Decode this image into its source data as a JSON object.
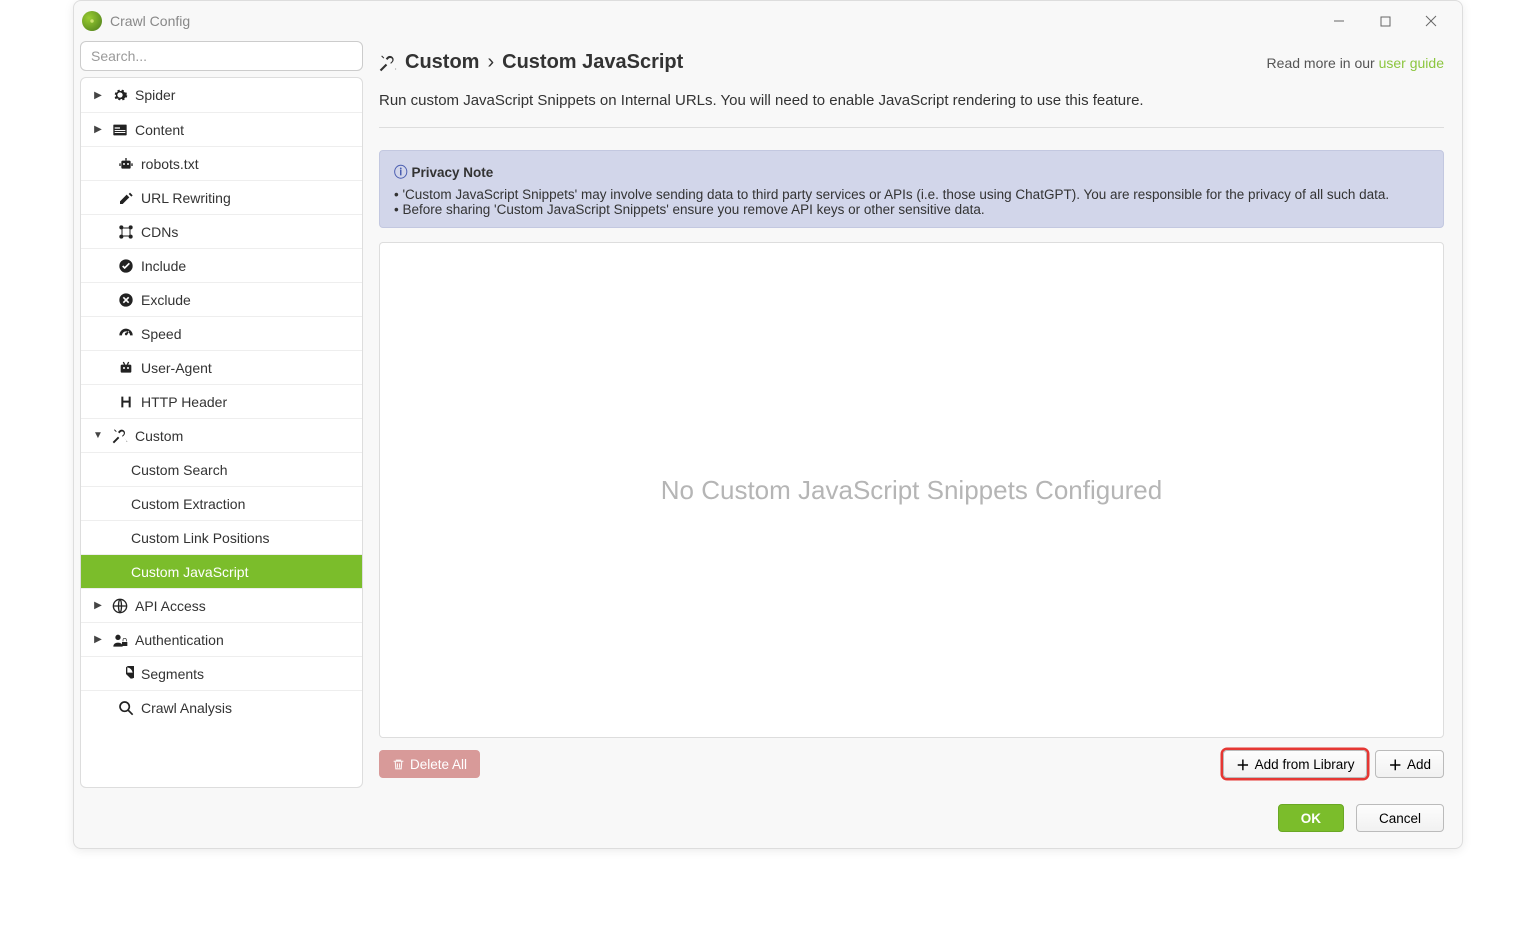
{
  "window": {
    "title": "Crawl Config"
  },
  "search": {
    "placeholder": "Search..."
  },
  "sidebar": {
    "items": [
      {
        "caret": "▶",
        "icon": "gear",
        "label": "Spider",
        "lvl": 0
      },
      {
        "caret": "▶",
        "icon": "content",
        "label": "Content",
        "lvl": 0
      },
      {
        "caret": "",
        "icon": "robot",
        "label": "robots.txt",
        "lvl": 1
      },
      {
        "caret": "",
        "icon": "rewrite",
        "label": "URL Rewriting",
        "lvl": 1
      },
      {
        "caret": "",
        "icon": "cdn",
        "label": "CDNs",
        "lvl": 1
      },
      {
        "caret": "",
        "icon": "check-circle",
        "label": "Include",
        "lvl": 1
      },
      {
        "caret": "",
        "icon": "x-circle",
        "label": "Exclude",
        "lvl": 1
      },
      {
        "caret": "",
        "icon": "gauge",
        "label": "Speed",
        "lvl": 1
      },
      {
        "caret": "",
        "icon": "user-agent",
        "label": "User-Agent",
        "lvl": 1
      },
      {
        "caret": "",
        "icon": "H",
        "label": "HTTP Header",
        "lvl": 1
      },
      {
        "caret": "▼",
        "icon": "tools",
        "label": "Custom",
        "lvl": 0
      },
      {
        "caret": "",
        "icon": "",
        "label": "Custom Search",
        "lvl": 2
      },
      {
        "caret": "",
        "icon": "",
        "label": "Custom Extraction",
        "lvl": 2
      },
      {
        "caret": "",
        "icon": "",
        "label": "Custom Link Positions",
        "lvl": 2
      },
      {
        "caret": "",
        "icon": "",
        "label": "Custom JavaScript",
        "lvl": 2,
        "selected": true
      },
      {
        "caret": "▶",
        "icon": "globe",
        "label": "API Access",
        "lvl": 0
      },
      {
        "caret": "▶",
        "icon": "lock",
        "label": "Authentication",
        "lvl": 0
      },
      {
        "caret": "",
        "icon": "pie",
        "label": "Segments",
        "lvl": 1
      },
      {
        "caret": "",
        "icon": "search",
        "label": "Crawl Analysis",
        "lvl": 1
      }
    ]
  },
  "page": {
    "breadcrumb": {
      "root": "Custom",
      "leaf": "Custom JavaScript",
      "sep": "›"
    },
    "readmore": {
      "prefix": "Read more in our ",
      "link": "user guide"
    },
    "description": "Run custom JavaScript Snippets on Internal URLs. You will need to enable JavaScript rendering to use this feature.",
    "privacy": {
      "title": "Privacy Note",
      "lines": [
        "'Custom JavaScript Snippets' may involve sending data to third party services or APIs (i.e. those using ChatGPT). You are responsible for the privacy of all such data.",
        "Before sharing 'Custom JavaScript Snippets' ensure you remove API keys or other sensitive data."
      ]
    },
    "emptyState": "No Custom JavaScript Snippets Configured"
  },
  "actions": {
    "deleteAll": "Delete All",
    "addFromLibrary": "Add from Library",
    "add": "Add"
  },
  "footer": {
    "ok": "OK",
    "cancel": "Cancel"
  }
}
